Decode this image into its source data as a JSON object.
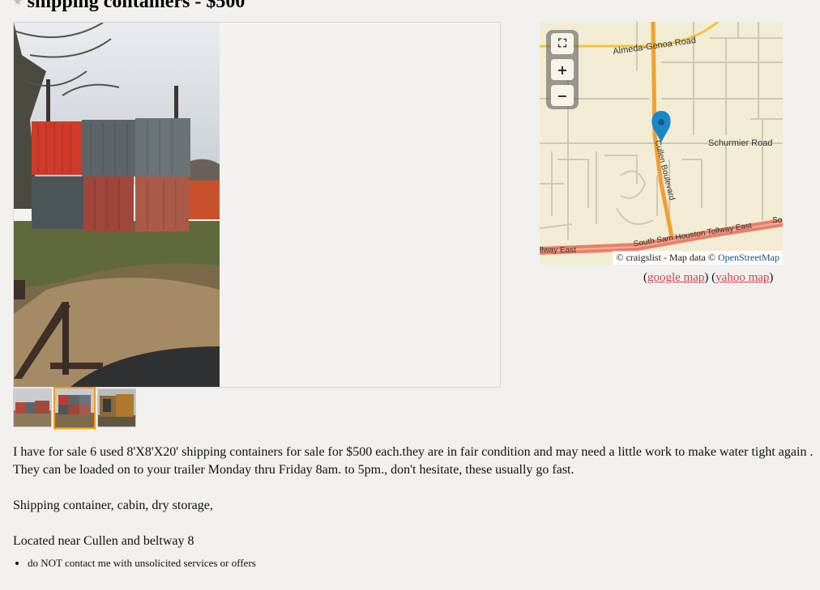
{
  "listing": {
    "title": "shipping containers - $500"
  },
  "gallery": {
    "thumbnail_count": 3,
    "selected_thumbnail_index": 2
  },
  "map": {
    "labels": {
      "road_north": "Almeda-Genoa Road",
      "road_east": "Schurmier Road",
      "road_main": "Cullen Boulevard",
      "tollway": "South Sam Houston Tollway East",
      "tollway_left": "llway East",
      "tollway_right": "So"
    },
    "attribution_prefix": "© craigslist - Map data ©",
    "attribution_link": "OpenStreetMap",
    "zoom_in": "+",
    "zoom_out": "−",
    "links": {
      "open": "(",
      "google": "google map",
      "mid": ") (",
      "yahoo": "yahoo map",
      "close": ")"
    }
  },
  "body": {
    "paragraph1": "I have for sale 6 used 8'X8'X20' shipping containers for sale for $500 each.they are in fair condition and may need a little work to make water tight again . They can be loaded on to your trailer Monday thru Friday 8am. to 5pm., don't hesitate, these usually go fast.",
    "paragraph2": "Shipping container, cabin, dry storage,",
    "paragraph3": "Located near Cullen and beltway 8"
  },
  "notices": [
    "do NOT contact me with unsolicited services or offers"
  ],
  "colors": {
    "link": "#d8404a",
    "thumb_selected": "#ff9900",
    "map_road_major": "#f0a030",
    "map_tollway": "#e8806a",
    "map_pin": "#1a87c9"
  }
}
